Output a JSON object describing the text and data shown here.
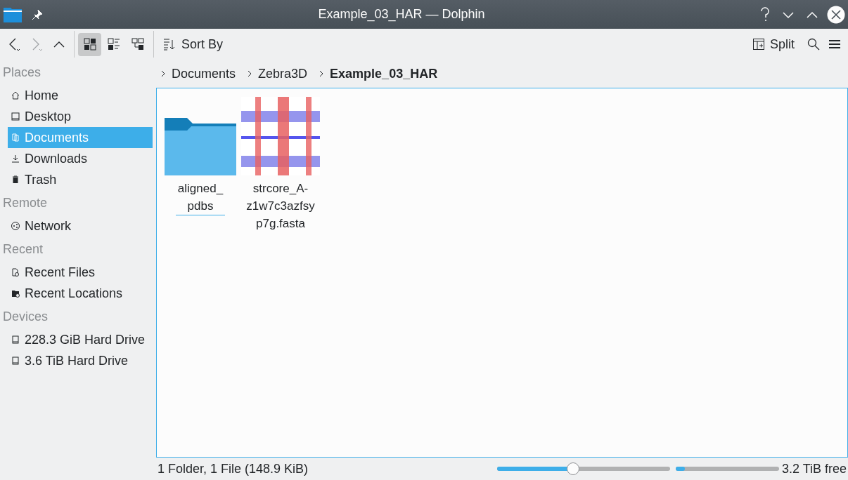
{
  "window": {
    "title": "Example_03_HAR — Dolphin"
  },
  "toolbar": {
    "view_modes": [
      {
        "kind": "icons",
        "selected": true
      },
      {
        "kind": "compact",
        "selected": false
      },
      {
        "kind": "details",
        "selected": false
      }
    ],
    "sort_label": "Sort By",
    "split_label": "Split"
  },
  "sidebar": [
    {
      "heading": "Places",
      "items": [
        {
          "kind": "home",
          "label": "Home",
          "selected": false
        },
        {
          "kind": "desktop",
          "label": "Desktop",
          "selected": false
        },
        {
          "kind": "documents",
          "label": "Documents",
          "selected": true
        },
        {
          "kind": "downloads",
          "label": "Downloads",
          "selected": false
        },
        {
          "kind": "trash",
          "label": "Trash",
          "selected": false
        }
      ]
    },
    {
      "heading": "Remote",
      "items": [
        {
          "kind": "network",
          "label": "Network",
          "selected": false
        }
      ]
    },
    {
      "heading": "Recent",
      "items": [
        {
          "kind": "recent-file",
          "label": "Recent Files",
          "selected": false
        },
        {
          "kind": "recent-folder",
          "label": "Recent Locations",
          "selected": false
        }
      ]
    },
    {
      "heading": "Devices",
      "items": [
        {
          "kind": "drive",
          "label": "228.3 GiB Hard Drive",
          "selected": false
        },
        {
          "kind": "drive",
          "label": "3.6 TiB Hard Drive",
          "selected": false
        }
      ]
    }
  ],
  "breadcrumb": [
    {
      "label": "Documents",
      "current": false
    },
    {
      "label": "Zebra3D",
      "current": false
    },
    {
      "label": "Example_03_HAR",
      "current": true
    }
  ],
  "files": [
    {
      "kind": "folder",
      "name": "aligned_pdbs",
      "focused": true
    },
    {
      "kind": "fasta",
      "name": "strcore_A-z1w7c3azfsyp7g.fasta",
      "focused": false
    }
  ],
  "status_bar": {
    "summary": "1 Folder, 1 File (148.9 KiB)",
    "zoom": {
      "level": 0.44
    },
    "disk": {
      "level": 0.09
    },
    "free_space": "3.2 TiB free"
  }
}
